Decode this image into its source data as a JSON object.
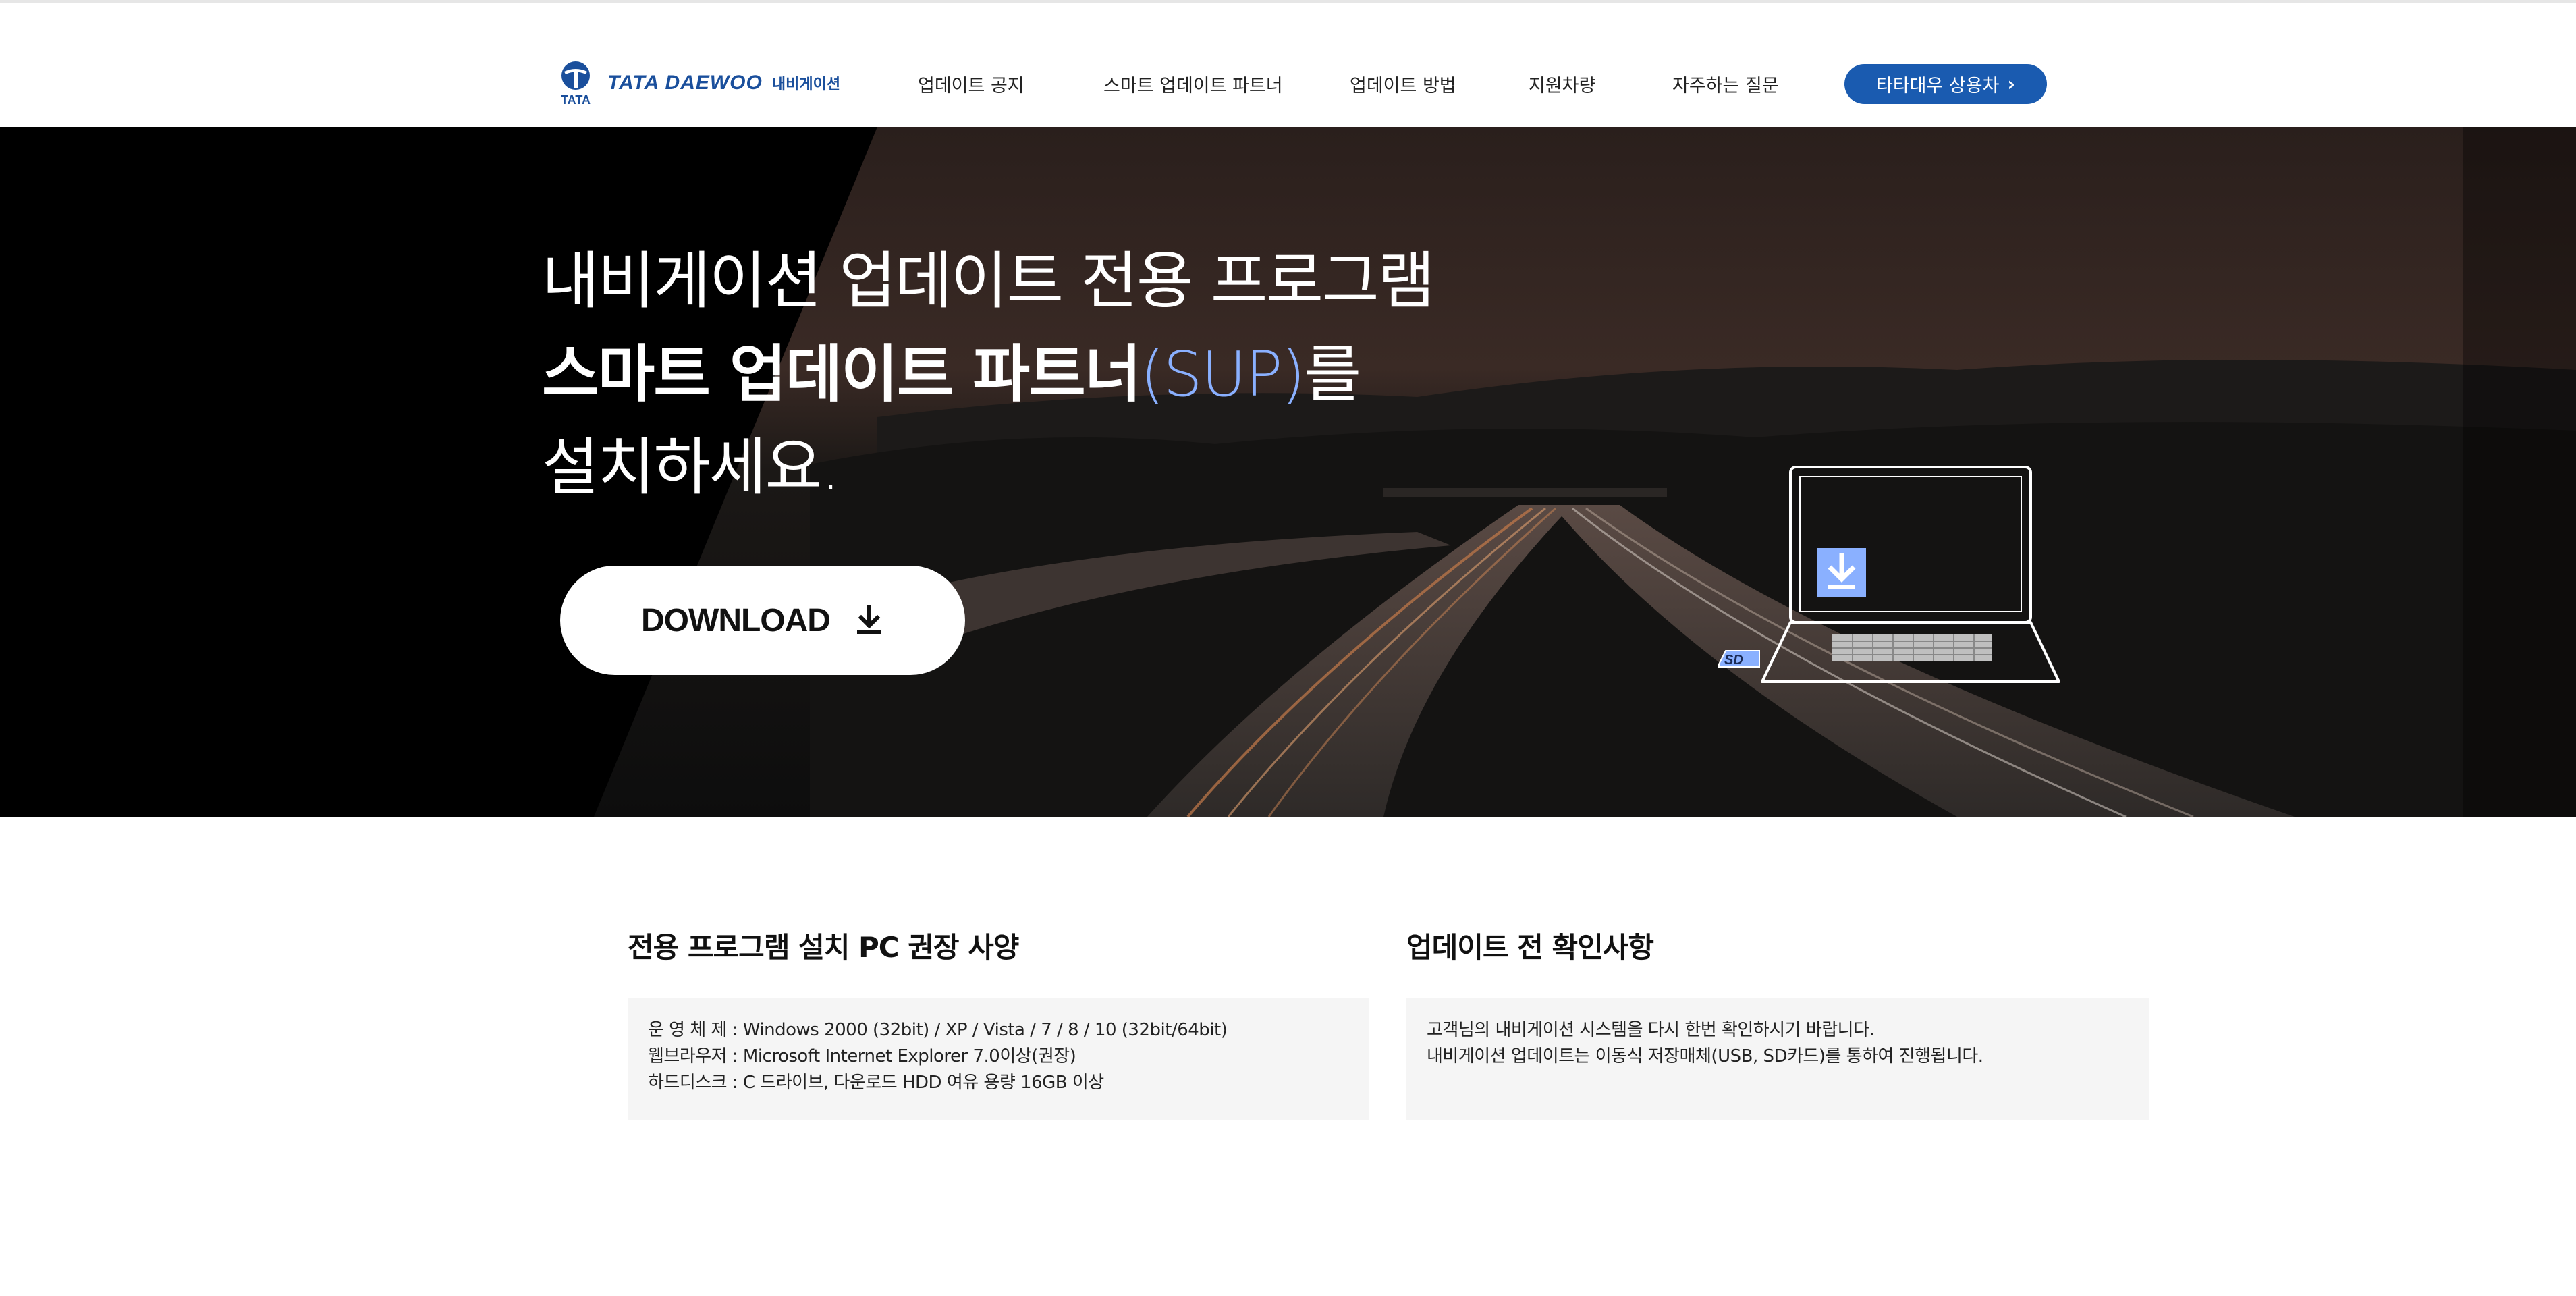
{
  "header": {
    "logo": {
      "mark_text": "TATA",
      "wordmark": "TATA DAEWOO",
      "sub": "내비게이션"
    },
    "nav": [
      {
        "label": "업데이트 공지"
      },
      {
        "label": "스마트 업데이트 파트너"
      },
      {
        "label": "업데이트 방법"
      },
      {
        "label": "지원차량"
      },
      {
        "label": "자주하는 질문"
      }
    ],
    "cta": {
      "label": "타타대우 상용차",
      "icon": "chevron-right-icon"
    }
  },
  "hero": {
    "line1": "내비게이션 업데이트 전용 프로그램",
    "line2_main": "스마트 업데이트 파트너",
    "line2_accent": "(SUP)",
    "line2_tail": "를",
    "line3": "설치하세요.",
    "download_label": "DOWNLOAD",
    "download_icon": "download-icon",
    "illustration": {
      "icon": "laptop-icon",
      "sd_label": "SD"
    },
    "colors": {
      "accent": "#8ab0ff",
      "brand": "#1a5bb0"
    }
  },
  "specs": {
    "title": "전용 프로그램 설치 PC 권장 사양",
    "lines": [
      "운 영 체 제  : Windows 2000 (32bit) / XP / Vista / 7 / 8 / 10 (32bit/64bit)",
      "웹브라우저 : Microsoft Internet Explorer 7.0이상(권장)",
      "하드디스크 : C 드라이브, 다운로드 HDD 여유 용량 16GB 이상"
    ]
  },
  "notice": {
    "title": "업데이트 전 확인사항",
    "lines": [
      "고객님의 내비게이션 시스템을 다시 한번 확인하시기 바랍니다.",
      "내비게이션 업데이트는 이동식 저장매체(USB, SD카드)를 통하여 진행됩니다."
    ]
  }
}
